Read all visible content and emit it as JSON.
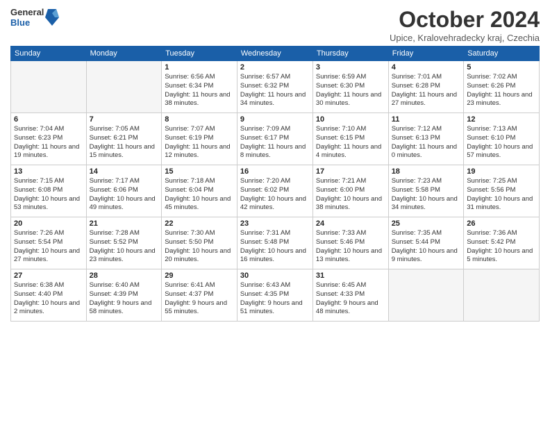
{
  "header": {
    "logo_general": "General",
    "logo_blue": "Blue",
    "month_title": "October 2024",
    "location": "Upice, Kralovehradecky kraj, Czechia"
  },
  "days_of_week": [
    "Sunday",
    "Monday",
    "Tuesday",
    "Wednesday",
    "Thursday",
    "Friday",
    "Saturday"
  ],
  "weeks": [
    [
      {
        "day": "",
        "info": ""
      },
      {
        "day": "",
        "info": ""
      },
      {
        "day": "1",
        "info": "Sunrise: 6:56 AM\nSunset: 6:34 PM\nDaylight: 11 hours and 38 minutes."
      },
      {
        "day": "2",
        "info": "Sunrise: 6:57 AM\nSunset: 6:32 PM\nDaylight: 11 hours and 34 minutes."
      },
      {
        "day": "3",
        "info": "Sunrise: 6:59 AM\nSunset: 6:30 PM\nDaylight: 11 hours and 30 minutes."
      },
      {
        "day": "4",
        "info": "Sunrise: 7:01 AM\nSunset: 6:28 PM\nDaylight: 11 hours and 27 minutes."
      },
      {
        "day": "5",
        "info": "Sunrise: 7:02 AM\nSunset: 6:26 PM\nDaylight: 11 hours and 23 minutes."
      }
    ],
    [
      {
        "day": "6",
        "info": "Sunrise: 7:04 AM\nSunset: 6:23 PM\nDaylight: 11 hours and 19 minutes."
      },
      {
        "day": "7",
        "info": "Sunrise: 7:05 AM\nSunset: 6:21 PM\nDaylight: 11 hours and 15 minutes."
      },
      {
        "day": "8",
        "info": "Sunrise: 7:07 AM\nSunset: 6:19 PM\nDaylight: 11 hours and 12 minutes."
      },
      {
        "day": "9",
        "info": "Sunrise: 7:09 AM\nSunset: 6:17 PM\nDaylight: 11 hours and 8 minutes."
      },
      {
        "day": "10",
        "info": "Sunrise: 7:10 AM\nSunset: 6:15 PM\nDaylight: 11 hours and 4 minutes."
      },
      {
        "day": "11",
        "info": "Sunrise: 7:12 AM\nSunset: 6:13 PM\nDaylight: 11 hours and 0 minutes."
      },
      {
        "day": "12",
        "info": "Sunrise: 7:13 AM\nSunset: 6:10 PM\nDaylight: 10 hours and 57 minutes."
      }
    ],
    [
      {
        "day": "13",
        "info": "Sunrise: 7:15 AM\nSunset: 6:08 PM\nDaylight: 10 hours and 53 minutes."
      },
      {
        "day": "14",
        "info": "Sunrise: 7:17 AM\nSunset: 6:06 PM\nDaylight: 10 hours and 49 minutes."
      },
      {
        "day": "15",
        "info": "Sunrise: 7:18 AM\nSunset: 6:04 PM\nDaylight: 10 hours and 45 minutes."
      },
      {
        "day": "16",
        "info": "Sunrise: 7:20 AM\nSunset: 6:02 PM\nDaylight: 10 hours and 42 minutes."
      },
      {
        "day": "17",
        "info": "Sunrise: 7:21 AM\nSunset: 6:00 PM\nDaylight: 10 hours and 38 minutes."
      },
      {
        "day": "18",
        "info": "Sunrise: 7:23 AM\nSunset: 5:58 PM\nDaylight: 10 hours and 34 minutes."
      },
      {
        "day": "19",
        "info": "Sunrise: 7:25 AM\nSunset: 5:56 PM\nDaylight: 10 hours and 31 minutes."
      }
    ],
    [
      {
        "day": "20",
        "info": "Sunrise: 7:26 AM\nSunset: 5:54 PM\nDaylight: 10 hours and 27 minutes."
      },
      {
        "day": "21",
        "info": "Sunrise: 7:28 AM\nSunset: 5:52 PM\nDaylight: 10 hours and 23 minutes."
      },
      {
        "day": "22",
        "info": "Sunrise: 7:30 AM\nSunset: 5:50 PM\nDaylight: 10 hours and 20 minutes."
      },
      {
        "day": "23",
        "info": "Sunrise: 7:31 AM\nSunset: 5:48 PM\nDaylight: 10 hours and 16 minutes."
      },
      {
        "day": "24",
        "info": "Sunrise: 7:33 AM\nSunset: 5:46 PM\nDaylight: 10 hours and 13 minutes."
      },
      {
        "day": "25",
        "info": "Sunrise: 7:35 AM\nSunset: 5:44 PM\nDaylight: 10 hours and 9 minutes."
      },
      {
        "day": "26",
        "info": "Sunrise: 7:36 AM\nSunset: 5:42 PM\nDaylight: 10 hours and 5 minutes."
      }
    ],
    [
      {
        "day": "27",
        "info": "Sunrise: 6:38 AM\nSunset: 4:40 PM\nDaylight: 10 hours and 2 minutes."
      },
      {
        "day": "28",
        "info": "Sunrise: 6:40 AM\nSunset: 4:39 PM\nDaylight: 9 hours and 58 minutes."
      },
      {
        "day": "29",
        "info": "Sunrise: 6:41 AM\nSunset: 4:37 PM\nDaylight: 9 hours and 55 minutes."
      },
      {
        "day": "30",
        "info": "Sunrise: 6:43 AM\nSunset: 4:35 PM\nDaylight: 9 hours and 51 minutes."
      },
      {
        "day": "31",
        "info": "Sunrise: 6:45 AM\nSunset: 4:33 PM\nDaylight: 9 hours and 48 minutes."
      },
      {
        "day": "",
        "info": ""
      },
      {
        "day": "",
        "info": ""
      }
    ]
  ]
}
